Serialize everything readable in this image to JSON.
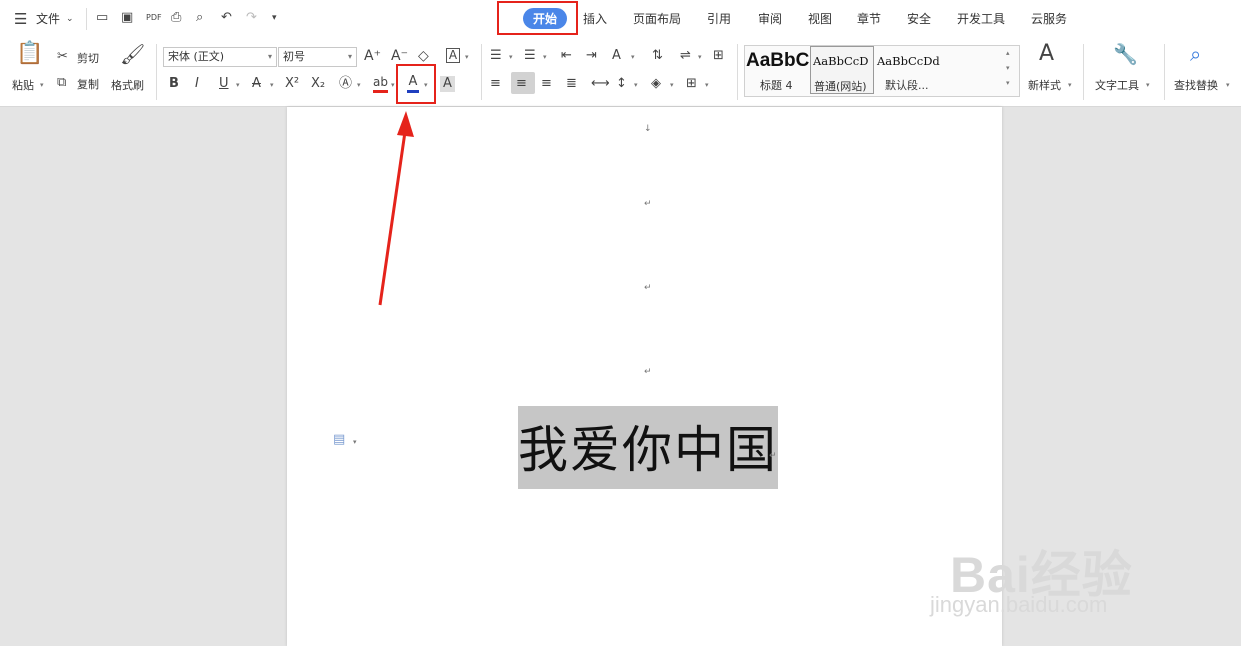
{
  "menubar": {
    "file_label": "文件",
    "tabs": [
      "开始",
      "插入",
      "页面布局",
      "引用",
      "审阅",
      "视图",
      "章节",
      "安全",
      "开发工具",
      "云服务"
    ],
    "active_tab": "开始"
  },
  "clipboard": {
    "paste": "粘贴",
    "cut": "剪切",
    "copy": "复制",
    "format_painter": "格式刷"
  },
  "font": {
    "family": "宋体 (正文)",
    "size": "初号"
  },
  "styles": [
    {
      "preview": "AaBbC",
      "name": "标题 4"
    },
    {
      "preview": "AaBbCcD",
      "name": "普通(网站)"
    },
    {
      "preview": "AaBbCcDd",
      "name": "默认段..."
    }
  ],
  "tools": {
    "new_style": "新样式",
    "text_tools": "文字工具",
    "find_replace": "查找替换"
  },
  "document": {
    "selected_text": "我爱你中国"
  },
  "watermark": {
    "brand": "Bai经验",
    "url": "jingyan.baidu.com"
  },
  "colors": {
    "accent": "#4a86e8",
    "highlight_red": "#e5231b",
    "font_color_bar": "#1f3fbf"
  }
}
